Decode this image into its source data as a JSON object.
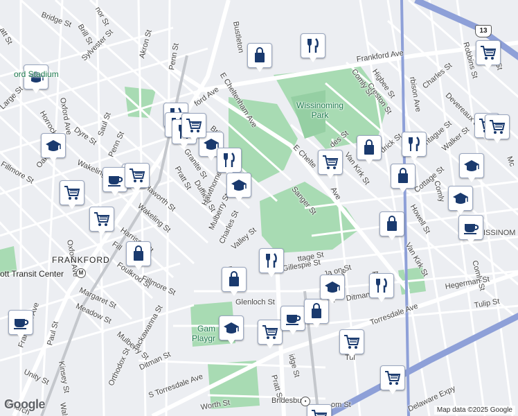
{
  "streets": [
    {
      "id": "bridge-st-nw",
      "text": "Bridge St"
    },
    {
      "id": "brill-st-nw",
      "text": "Brill St"
    },
    {
      "id": "mor-st",
      "text": "nor St"
    },
    {
      "id": "sylvester-st",
      "text": "Sylvester St"
    },
    {
      "id": "akron-st",
      "text": "Akron St"
    },
    {
      "id": "penn-st-n",
      "text": "Penn St"
    },
    {
      "id": "bustleton",
      "text": "Bustleton"
    },
    {
      "id": "frankford-ave-ne",
      "text": "Frankford Ave"
    },
    {
      "id": "e-cheltenham-ave",
      "text": "E Cheltenham Ave"
    },
    {
      "id": "ford-ave",
      "text": "ford Ave"
    },
    {
      "id": "brill-st-mid",
      "text": "Brill"
    },
    {
      "id": "horrocks-st",
      "text": "Horrocks St"
    },
    {
      "id": "large-st",
      "text": "Large St"
    },
    {
      "id": "oxford-ave-n",
      "text": "Oxford Ave"
    },
    {
      "id": "dyre-st",
      "text": "Dyre St"
    },
    {
      "id": "saul-st",
      "text": "Saul St"
    },
    {
      "id": "oakl-st",
      "text": "Oakl"
    },
    {
      "id": "fillmore-st-w",
      "text": "Fillmore St"
    },
    {
      "id": "wakeling-st-w",
      "text": "Wakeling"
    },
    {
      "id": "penn-st-s",
      "text": "Penn St"
    },
    {
      "id": "granite-st",
      "text": "Granite St"
    },
    {
      "id": "pratt-st-n",
      "text": "Pratt St"
    },
    {
      "id": "duffield-st",
      "text": "Duffield St"
    },
    {
      "id": "haworth-st",
      "text": "Haworth St"
    },
    {
      "id": "wakeling-st",
      "text": "Wakeling St"
    },
    {
      "id": "hawthorne-st",
      "text": "Hawthorne St"
    },
    {
      "id": "mulberry-st-n",
      "text": "Mulberry St"
    },
    {
      "id": "charles-st-w",
      "text": "Charles St"
    },
    {
      "id": "valley-st",
      "text": "Valley St"
    },
    {
      "id": "harrison-st",
      "text": "Harrison St"
    },
    {
      "id": "fillmore-st-2",
      "text": "Fill"
    },
    {
      "id": "foulkrod-st",
      "text": "Foulkrod St"
    },
    {
      "id": "oxford-ave-s",
      "text": "Oxford Ave"
    },
    {
      "id": "margaret-st",
      "text": "Margaret St"
    },
    {
      "id": "meadow-st",
      "text": "Meadow St"
    },
    {
      "id": "fillmore-st-s",
      "text": "Fillmore St"
    },
    {
      "id": "haw",
      "text": "Haw"
    },
    {
      "id": "frankford-ave-s",
      "text": "Frankford Ave"
    },
    {
      "id": "paul-st",
      "text": "Paul St"
    },
    {
      "id": "kinsey-st",
      "text": "Kinsey St"
    },
    {
      "id": "unity-st",
      "text": "Unity St"
    },
    {
      "id": "church-st",
      "text": "Church"
    },
    {
      "id": "waln-st",
      "text": "Waln St"
    },
    {
      "id": "mulberry-st-s",
      "text": "Mulberry St"
    },
    {
      "id": "tackawanna-st",
      "text": "Tackawanna St"
    },
    {
      "id": "ditman-st-w",
      "text": "Ditman St"
    },
    {
      "id": "orthodox-st",
      "text": "Orthodox St"
    },
    {
      "id": "torresdale-ave-w",
      "text": "S Torresdale Ave"
    },
    {
      "id": "worth-st",
      "text": "Worth St"
    },
    {
      "id": "glenloch-st",
      "text": "Glenloch St"
    },
    {
      "id": "pratt-st-s",
      "text": "Pratt St"
    },
    {
      "id": "bridge-st-s",
      "text": "idge St"
    },
    {
      "id": "bridesburg",
      "text": "Bridesburg"
    },
    {
      "id": "om-st",
      "text": "om St"
    },
    {
      "id": "sanger-st",
      "text": "Sanger St"
    },
    {
      "id": "e-cheltenham-ave-2",
      "text": "E Chelte"
    },
    {
      "id": "ave-se",
      "text": "Ave"
    },
    {
      "id": "cottage-st-mid",
      "text": "ttage St"
    },
    {
      "id": "gillespie-st",
      "text": "Gillespie St"
    },
    {
      "id": "jackson-st",
      "text": "Ja   on St"
    },
    {
      "id": "harbison-ave-s",
      "text": "rbison Ave"
    },
    {
      "id": "ditman-st-e",
      "text": "Ditman"
    },
    {
      "id": "torresdale-ave-e",
      "text": "Torresdale Ave"
    },
    {
      "id": "tulip-st-s",
      "text": "Tul"
    },
    {
      "id": "comly-st-n",
      "text": "Comly St"
    },
    {
      "id": "higbee-st",
      "text": "Higbee St"
    },
    {
      "id": "creston-st",
      "text": "Creston St"
    },
    {
      "id": "harbison-ave-n",
      "text": "rbison Ave"
    },
    {
      "id": "charles-st-e",
      "text": "Charles St"
    },
    {
      "id": "devereaux-st",
      "text": "Devereaux St"
    },
    {
      "id": "des-st",
      "text": "des St"
    },
    {
      "id": "van-kirk-st-n",
      "text": "Van Kirk St"
    },
    {
      "id": "rdrick-st",
      "text": "rdrick St"
    },
    {
      "id": "montague-st",
      "text": "ontague St"
    },
    {
      "id": "walker-st",
      "text": "Walker St"
    },
    {
      "id": "cottage-st-e",
      "text": "Cottage St"
    },
    {
      "id": "comly-st-mid",
      "text": "Comly"
    },
    {
      "id": "howell-st",
      "text": "Howell St"
    },
    {
      "id": "van-kirk-st-s",
      "text": "Van Kirk St"
    },
    {
      "id": "an-st",
      "text": "An"
    },
    {
      "id": "comly-st-s",
      "text": "Comly St"
    },
    {
      "id": "hegerman-st",
      "text": "Hegerman St"
    },
    {
      "id": "tulip-st-e",
      "text": "Tulip St"
    },
    {
      "id": "robbins-st",
      "text": "Robbins St"
    },
    {
      "id": "ng-st",
      "text": "ng St"
    },
    {
      "id": "mc",
      "text": "Mc"
    },
    {
      "id": "delaware-expy",
      "text": "Delaware Expy"
    },
    {
      "id": "att-st",
      "text": "att St"
    },
    {
      "id": "ssinom",
      "text": "ISSINOM"
    }
  ],
  "places": {
    "stadium": "ord Stadium",
    "park": "Wissinoming\nPark",
    "frankford": "FRANKFORD",
    "transit": "ott Transit Center",
    "playground_a": "Gam",
    "playground_b": "Playgr"
  },
  "route_shield": "13",
  "attribution": "Map data ©2025 Google",
  "google_logo": "Google",
  "colors": {
    "land": "#eceef2",
    "park": "#a8dbb3",
    "road": "#ffffff",
    "highway": "#8ea0d8",
    "rail": "#c4c7cc",
    "poi_icon": "#1a3a6e"
  },
  "pois": [
    {
      "id": "shopping-1",
      "type": "shopping"
    },
    {
      "id": "food-1",
      "type": "food"
    },
    {
      "id": "grocery-1",
      "type": "grocery"
    },
    {
      "id": "school-1",
      "type": "school"
    },
    {
      "id": "school-2",
      "type": "school"
    },
    {
      "id": "food-2",
      "type": "food"
    },
    {
      "id": "food-3",
      "type": "food"
    },
    {
      "id": "food-4",
      "type": "food"
    },
    {
      "id": "school-3",
      "type": "school"
    },
    {
      "id": "food-5",
      "type": "food"
    },
    {
      "id": "school-4",
      "type": "school"
    },
    {
      "id": "food-6",
      "type": "food"
    },
    {
      "id": "cafe-1",
      "type": "cafe"
    },
    {
      "id": "grocery-2",
      "type": "grocery"
    },
    {
      "id": "grocery-3",
      "type": "grocery"
    },
    {
      "id": "shopping-2",
      "type": "shopping"
    },
    {
      "id": "food-7",
      "type": "food"
    },
    {
      "id": "shopping-3",
      "type": "shopping"
    },
    {
      "id": "cafe-2",
      "type": "cafe"
    },
    {
      "id": "school-5",
      "type": "school"
    },
    {
      "id": "grocery-4",
      "type": "grocery"
    },
    {
      "id": "cafe-3",
      "type": "cafe"
    },
    {
      "id": "shopping-4",
      "type": "shopping"
    },
    {
      "id": "grocery-5",
      "type": "grocery"
    },
    {
      "id": "shopping-5",
      "type": "shopping"
    },
    {
      "id": "grocery-6",
      "type": "grocery"
    },
    {
      "id": "food-8",
      "type": "food"
    },
    {
      "id": "shopping-6",
      "type": "shopping"
    },
    {
      "id": "school-6",
      "type": "school"
    },
    {
      "id": "food-9",
      "type": "food"
    },
    {
      "id": "grocery-7",
      "type": "grocery"
    },
    {
      "id": "shopping-7",
      "type": "shopping"
    },
    {
      "id": "school-7",
      "type": "school"
    },
    {
      "id": "cafe-4",
      "type": "cafe"
    },
    {
      "id": "grocery-8",
      "type": "grocery"
    },
    {
      "id": "grocery-9",
      "type": "grocery"
    },
    {
      "id": "grocery-10",
      "type": "grocery"
    },
    {
      "id": "school-8",
      "type": "school"
    },
    {
      "id": "grocery-11",
      "type": "grocery"
    },
    {
      "id": "grocery-12",
      "type": "grocery"
    }
  ]
}
